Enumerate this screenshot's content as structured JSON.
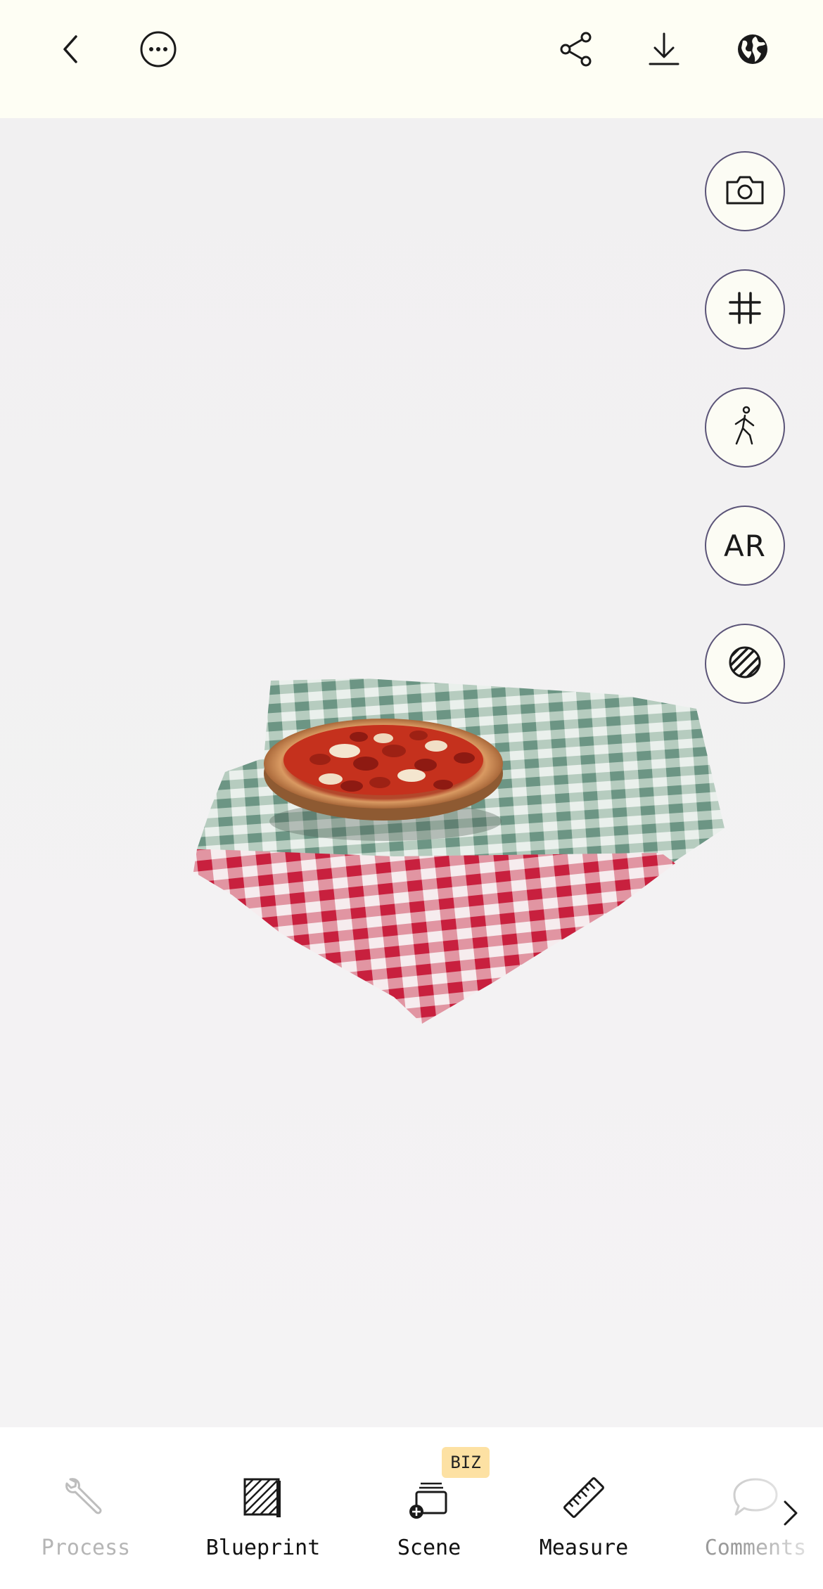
{
  "toolbar": {
    "back": "back-icon",
    "more": "more-icon",
    "share": "share-icon",
    "download": "download-icon",
    "globe": "globe-icon"
  },
  "viewer": {
    "subject": "pizza-on-checkered-tablecloth-3d-model",
    "side_buttons": [
      {
        "icon": "camera-icon"
      },
      {
        "icon": "grid-icon"
      },
      {
        "icon": "walk-icon"
      },
      {
        "icon": "ar-icon",
        "label": "AR"
      },
      {
        "icon": "texture-icon"
      }
    ]
  },
  "tabs": {
    "process": {
      "label": "Process",
      "icon": "wrench-icon",
      "enabled": false
    },
    "blueprint": {
      "label": "Blueprint",
      "icon": "blueprint-icon"
    },
    "scene": {
      "label": "Scene",
      "icon": "scene-add-icon",
      "badge": "BIZ"
    },
    "measure": {
      "label": "Measure",
      "icon": "ruler-icon"
    },
    "comments": {
      "label": "Comments",
      "icon": "comment-icon"
    }
  },
  "colors": {
    "topbar_bg": "#fefef4",
    "button_border": "#5b5478",
    "badge_bg": "#fde1a3",
    "disabled_text": "#b5b5b5"
  }
}
